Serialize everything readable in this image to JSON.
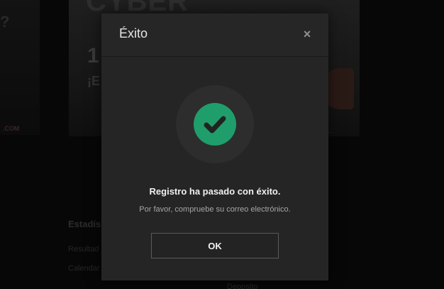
{
  "background": {
    "banner_title": "CYBER",
    "banner_number": "1",
    "banner_sub": "¡E",
    "left_letter": "?",
    "left_caption_prefix": "",
    "left_caption_suffix": ".COM",
    "right_caption": "...",
    "section_title": "Estadís",
    "link_1": "Resultad",
    "link_2": "Calendar",
    "link_3": "Deposito"
  },
  "modal": {
    "title": "Éxito",
    "close_label": "×",
    "message_title": "Registro ha pasado con éxito.",
    "message_body": "Por favor, compruebe su correo electrónico.",
    "ok_label": "OK",
    "icon": "check-circle-icon"
  },
  "colors": {
    "success": "#1f9e6b",
    "modal_bg": "#252525",
    "overlay": "#070707"
  }
}
